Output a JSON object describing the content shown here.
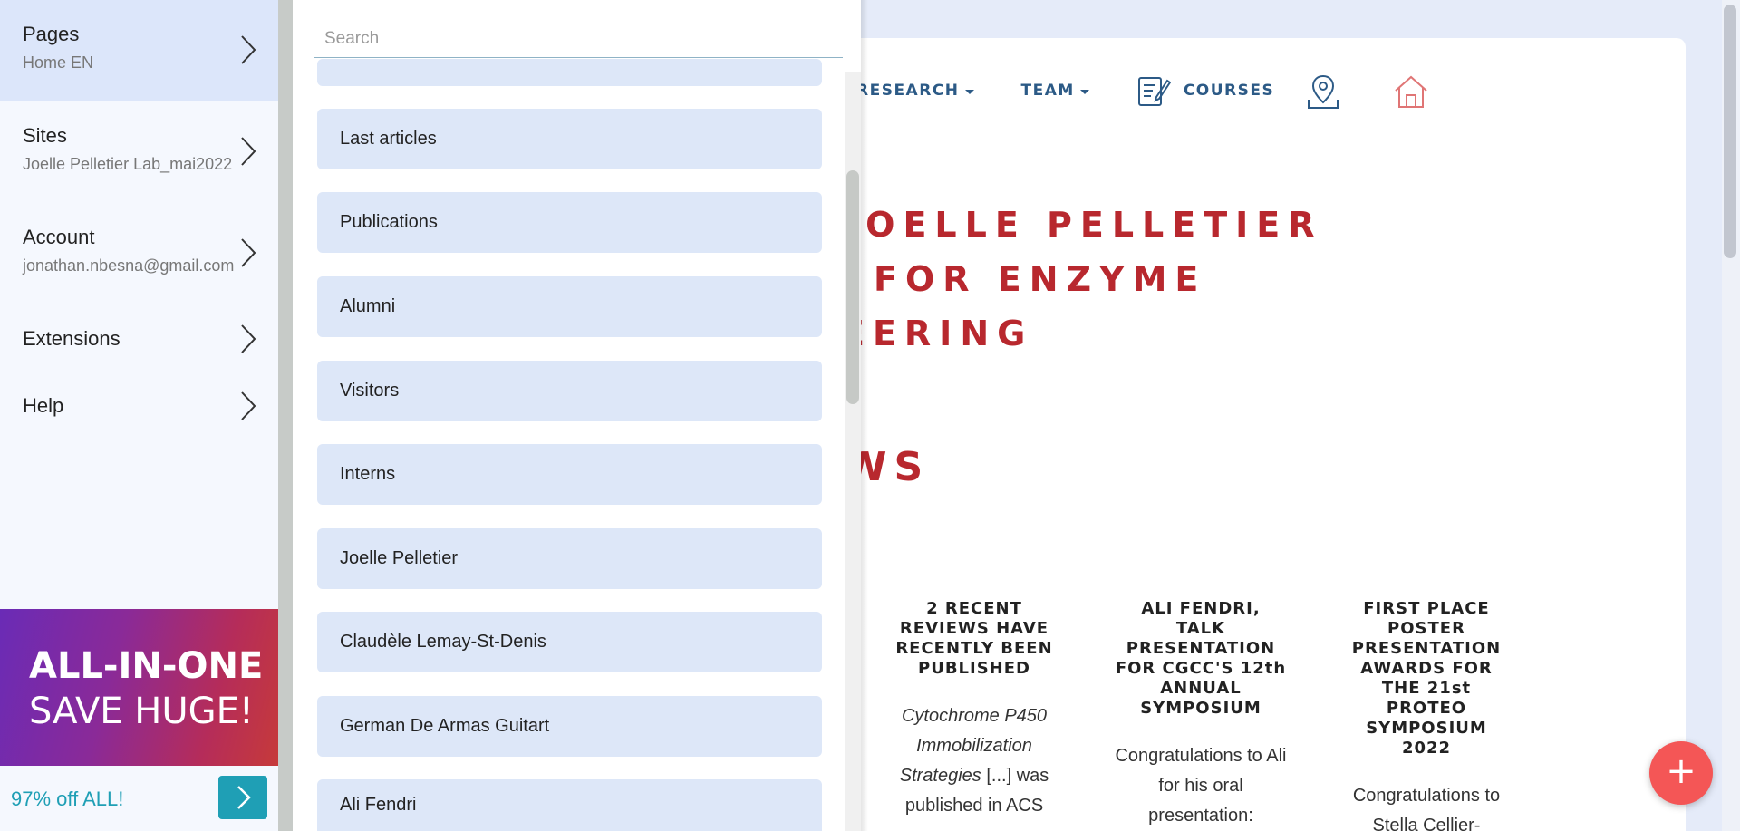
{
  "website": {
    "nav": {
      "research": "RESEARCH",
      "team": "TEAM",
      "courses": "COURSES"
    },
    "title_lines": [
      "JOELLE PELLETIER",
      "FOR ENZYME",
      "EERING"
    ],
    "news_heading": "WS",
    "news": [
      {
        "title": "2 RECENT REVIEWS HAVE RECENTLY BEEN PUBLISHED",
        "body_italic": "Cytochrome P450 Immobilization Strategies",
        "body_rest": " [...] was published in ACS"
      },
      {
        "title": "ALI FENDRI, TALK PRESENTATION FOR CGCC'S 12th ANNUAL SYMPOSIUM",
        "body": "Congratulations to Ali for his oral presentation:"
      },
      {
        "title": "FIRST PLACE POSTER PRESENTATION AWARDS FOR THE 21st PROTEO SYMPOSIUM 2022",
        "body": "Congratulations to Stella Cellier-Goetghebeur and"
      }
    ],
    "fab_label": "+"
  },
  "sidebar": {
    "items": [
      {
        "title": "Pages",
        "subtitle": "Home EN",
        "active": true
      },
      {
        "title": "Sites",
        "subtitle": "Joelle Pelletier Lab_mai2022"
      },
      {
        "title": "Account",
        "subtitle": "jonathan.nbesna@gmail.com"
      },
      {
        "title": "Extensions",
        "subtitle": ""
      },
      {
        "title": "Help",
        "subtitle": ""
      }
    ],
    "promo": {
      "line1": "ALL-IN-ONE",
      "line2": "SAVE HUGE!",
      "offer": "97% off ALL!"
    }
  },
  "pages_panel": {
    "search_placeholder": "Search",
    "items": [
      "Last articles",
      "Publications",
      "Alumni",
      "Visitors",
      "Interns",
      "Joelle Pelletier",
      "Claudèle Lemay-St-Denis",
      "German De Armas Guitart",
      "Ali Fendri"
    ]
  },
  "colors": {
    "accent_red": "#b8282e",
    "nav_blue": "#2c5a86",
    "panel_item_bg": "#dde7f8",
    "promo_teal": "#1f9fb5",
    "fab": "#f45656"
  },
  "icons": [
    "chevron-right-icon",
    "courses-edit-icon",
    "map-pin-icon",
    "home-icon",
    "plus-icon"
  ]
}
